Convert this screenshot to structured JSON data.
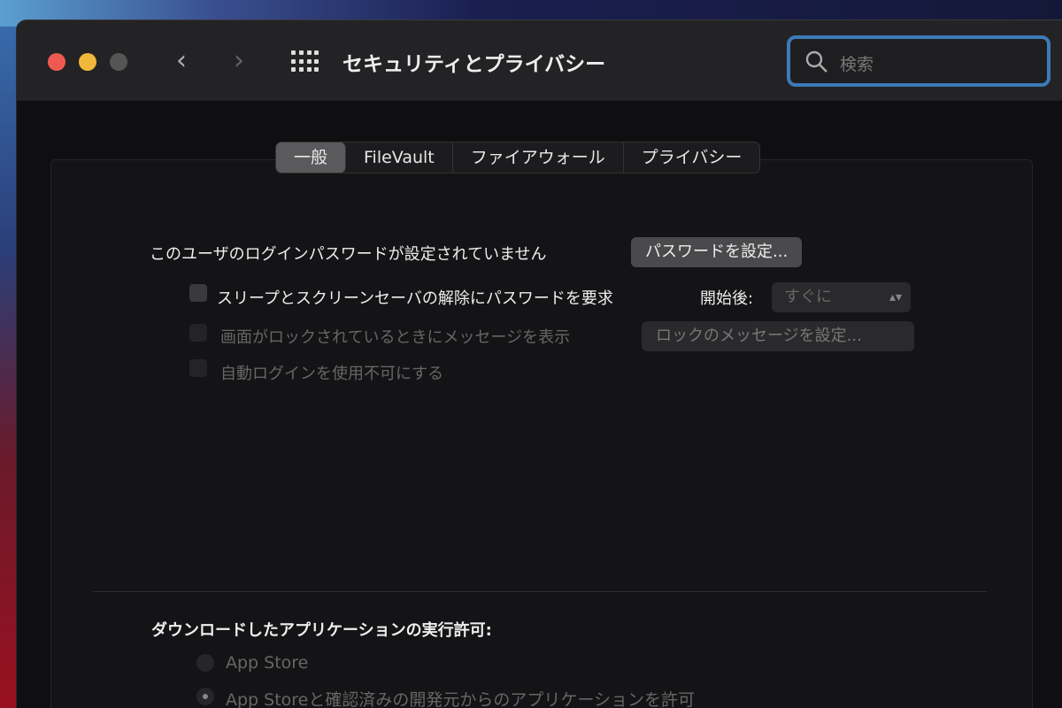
{
  "window": {
    "title": "セキュリティとプライバシー"
  },
  "search": {
    "placeholder": "検索"
  },
  "tabs": [
    {
      "label": "一般",
      "active": true
    },
    {
      "label": "FileVault",
      "active": false
    },
    {
      "label": "ファイアウォール",
      "active": false
    },
    {
      "label": "プライバシー",
      "active": false
    }
  ],
  "general": {
    "no_password_text": "このユーザのログインパスワードが設定されていません",
    "set_password_button": "パスワードを設定...",
    "require_password_label": "スリープとスクリーンセーバの解除にパスワードを要求",
    "require_password_checked": false,
    "after_label": "開始後:",
    "after_value": "すぐに",
    "show_message_label": "画面がロックされているときにメッセージを表示",
    "set_lock_message_button": "ロックのメッセージを設定...",
    "disable_auto_login_label": "自動ログインを使用不可にする"
  },
  "downloads": {
    "heading": "ダウンロードしたアプリケーションの実行許可:",
    "options": [
      {
        "label": "App Store",
        "selected": false
      },
      {
        "label": "App Storeと確認済みの開発元からのアプリケーションを許可",
        "selected": true
      }
    ]
  }
}
